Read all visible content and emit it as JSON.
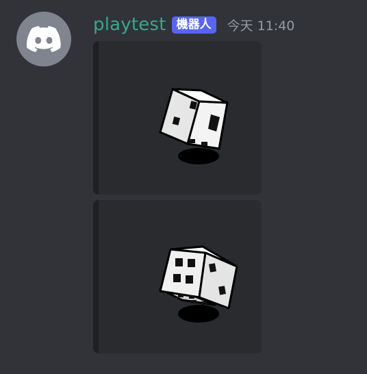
{
  "message": {
    "author": "playtest",
    "bot_tag": "機器人",
    "timestamp": "今天 11:40",
    "avatar_icon": "discord-logo-icon"
  },
  "attachments": [
    {
      "name": "dice-image-1",
      "shows": "d6 die"
    },
    {
      "name": "dice-image-2",
      "shows": "d6 die"
    }
  ],
  "colors": {
    "background": "#313338",
    "username": "#3ba58e",
    "bot_tag": "#5865f2",
    "timestamp": "#949ba4",
    "avatar": "#80848e"
  }
}
